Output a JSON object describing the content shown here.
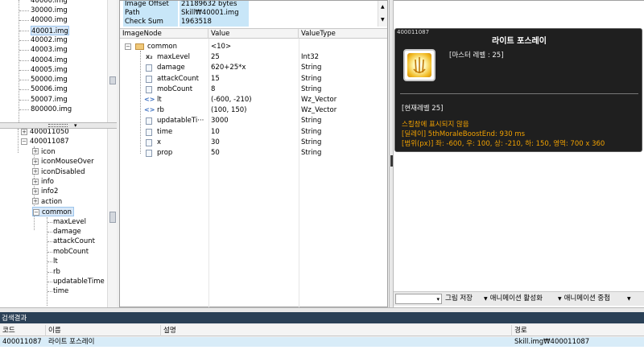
{
  "left_tree_top": {
    "items": [
      "30000.img",
      "40000.img",
      "40001.img",
      "40002.img",
      "40003.img",
      "40004.img",
      "40005.img",
      "50000.img",
      "50006.img",
      "50007.img",
      "800000.img"
    ],
    "selected_index": 2
  },
  "left_tree_bottom": {
    "parents": [
      "400011050",
      "400011087"
    ],
    "children": [
      "icon",
      "iconMouseOver",
      "iconDisabled",
      "info",
      "info2",
      "action",
      "common"
    ],
    "common_children": [
      "maxLevel",
      "damage",
      "attackCount",
      "mobCount",
      "lt",
      "rb",
      "updatableTime",
      "time"
    ]
  },
  "info_box": {
    "rows": [
      {
        "key": "Image Offset",
        "value": "21189632 bytes"
      },
      {
        "key": "Path",
        "value": "Skill₩40001.img"
      },
      {
        "key": "Check Sum",
        "value": "1963518"
      }
    ]
  },
  "grid": {
    "headers": {
      "node": "ImageNode",
      "value": "Value",
      "type": "ValueType"
    },
    "parent": {
      "name": "common",
      "value": "<10>"
    },
    "rows": [
      {
        "name": "maxLevel",
        "value": "25",
        "type": "Int32",
        "icon": "int-icon"
      },
      {
        "name": "damage",
        "value": "620+25*x",
        "type": "String",
        "icon": "string-icon"
      },
      {
        "name": "attackCount",
        "value": "15",
        "type": "String",
        "icon": "string-icon"
      },
      {
        "name": "mobCount",
        "value": "8",
        "type": "String",
        "icon": "string-icon"
      },
      {
        "name": "lt",
        "value": "(-600, -210)",
        "type": "Wz_Vector",
        "icon": "vector-icon"
      },
      {
        "name": "rb",
        "value": "(100, 150)",
        "type": "Wz_Vector",
        "icon": "vector-icon"
      },
      {
        "name": "updatableTi···",
        "value": "3000",
        "type": "String",
        "icon": "string-icon"
      },
      {
        "name": "time",
        "value": "10",
        "type": "String",
        "icon": "string-icon"
      },
      {
        "name": "x",
        "value": "30",
        "type": "String",
        "icon": "string-icon"
      },
      {
        "name": "prop",
        "value": "50",
        "type": "String",
        "icon": "string-icon"
      }
    ]
  },
  "tooltip": {
    "code": "400011087",
    "title": "라이트 포스레이",
    "mastery": "[마스터 레벨 : 25]",
    "current_level": "[현재레벨 25]",
    "lines": [
      "스킬창에 표시되지 않음",
      "[딜레이] 5thMoraleBoostEnd: 930 ms",
      "[범위(px)] 좌: -600, 우: 100, 상: -210, 하: 150, 영역: 700 x 360"
    ],
    "colors": {
      "background": "#1f1f1f",
      "highlight": "#f0a000"
    }
  },
  "right_toolbar": {
    "combo_value": "",
    "buttons": [
      "그림 저장",
      "애니메이션 활성화",
      "애니메이션 중첩"
    ]
  },
  "search_results": {
    "title": "검색결과",
    "columns": [
      "코드",
      "이름",
      "설명",
      "경로"
    ],
    "rows": [
      {
        "code": "400011087",
        "name": "라이트 포스레이",
        "desc": "",
        "path": "Skill.img₩400011087"
      }
    ]
  }
}
